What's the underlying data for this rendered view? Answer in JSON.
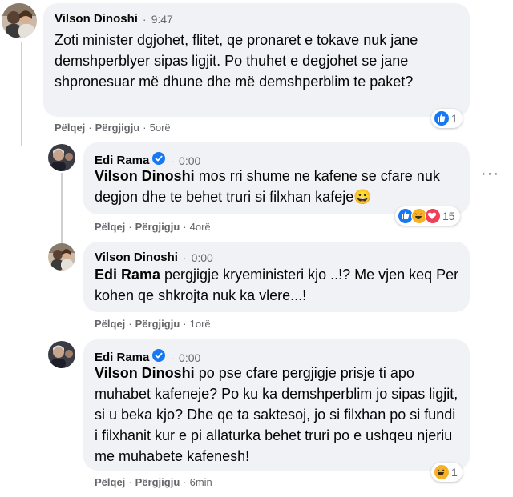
{
  "comments": [
    {
      "author": "Vilson Dinoshi",
      "time": "9:47",
      "text": "Zoti minister dgjohet, flitet, qe pronaret e tokave nuk jane demshperblyer sipas ligjit. Po thuhet e degjohet se jane shpronesuar më dhune dhe më demshperblim te paket?",
      "like": "Pëlqej",
      "reply": "Përgjigju",
      "ago": "5orë",
      "reaction_count": "1",
      "reaction_icons": [
        "like-icon"
      ]
    },
    {
      "author": "Edi Rama",
      "verified": true,
      "time": "0:00",
      "mention": "Vilson Dinoshi",
      "text": " mos rri shume ne kafene se cfare nuk degjon dhe te behet truri si filxhan kafeje😀",
      "like": "Pëlqej",
      "reply": "Përgjigju",
      "ago": "4orë",
      "reaction_count": "15",
      "reaction_icons": [
        "like-icon",
        "haha-icon",
        "love-icon"
      ]
    },
    {
      "author": "Vilson Dinoshi",
      "time": "0:00",
      "mention": "Edi Rama",
      "text": " pergjigje kryeministeri kjo ..!? Me vjen keq Per kohen qe shkrojta nuk ka vlere...!",
      "like": "Pëlqej",
      "reply": "Përgjigju",
      "ago": "1orë"
    },
    {
      "author": "Edi Rama",
      "verified": true,
      "time": "0:00",
      "mention": "Vilson Dinoshi",
      "text": " po pse cfare pergjigje prisje ti apo muhabet kafeneje? Po ku ka demshperblim jo sipas ligjit, si u beka kjo? Dhe qe ta saktesoj, jo si filxhan po si fundi i filxhanit kur e pi allaturka behet truri po e ushqeu njeriu me muhabete kafenesh!",
      "like": "Pëlqej",
      "reply": "Përgjigju",
      "ago": "6min",
      "reaction_count": "1",
      "reaction_icons": [
        "haha-icon"
      ]
    }
  ],
  "separator": "·",
  "colors": {
    "bubble": "#f0f2f5",
    "secondary_text": "#65676b",
    "like_blue": "#1877f2",
    "love_red": "#f33e58",
    "haha_yellow": "#f7b125"
  }
}
